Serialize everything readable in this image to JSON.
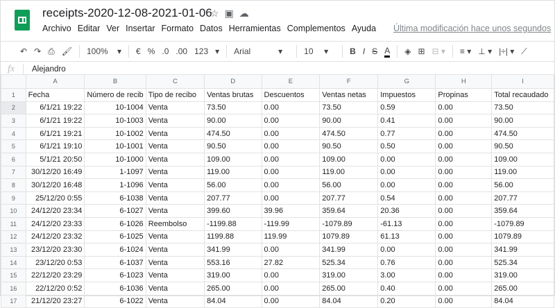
{
  "app": {
    "title": "receipts-2020-12-08-2021-01-06",
    "last_modified": "Última modificación hace unos segundos",
    "menu": [
      "Archivo",
      "Editar",
      "Ver",
      "Insertar",
      "Formato",
      "Datos",
      "Herramientas",
      "Complementos",
      "Ayuda"
    ]
  },
  "toolbar": {
    "zoom": "100%",
    "currency": "€",
    "percent": "%",
    "dec_less": ".0",
    "dec_more": ".00",
    "format": "123",
    "font": "Arial",
    "font_size": "10"
  },
  "formula_bar": {
    "fx": "fx",
    "value": "Alejandro"
  },
  "sheet": {
    "columns": [
      "A",
      "B",
      "C",
      "D",
      "E",
      "F",
      "G",
      "H",
      "I"
    ],
    "rows": [
      [
        "Fecha",
        "Número de recib",
        "Tipo de recibo",
        "Ventas brutas",
        "Descuentos",
        "Ventas netas",
        "Impuestos",
        "Propinas",
        "Total recaudado"
      ],
      [
        "6/1/21 19:22",
        "10-1004",
        "Venta",
        "73.50",
        "0.00",
        "73.50",
        "0.59",
        "0.00",
        "73.50"
      ],
      [
        "6/1/21 19:22",
        "10-1003",
        "Venta",
        "90.00",
        "0.00",
        "90.00",
        "0.41",
        "0.00",
        "90.00"
      ],
      [
        "6/1/21 19:21",
        "10-1002",
        "Venta",
        "474.50",
        "0.00",
        "474.50",
        "0.77",
        "0.00",
        "474.50"
      ],
      [
        "6/1/21 19:10",
        "10-1001",
        "Venta",
        "90.50",
        "0.00",
        "90.50",
        "0.50",
        "0.00",
        "90.50"
      ],
      [
        "5/1/21 20:50",
        "10-1000",
        "Venta",
        "109.00",
        "0.00",
        "109.00",
        "0.00",
        "0.00",
        "109.00"
      ],
      [
        "30/12/20 16:49",
        "1-1097",
        "Venta",
        "119.00",
        "0.00",
        "119.00",
        "0.00",
        "0.00",
        "119.00"
      ],
      [
        "30/12/20 16:48",
        "1-1096",
        "Venta",
        "56.00",
        "0.00",
        "56.00",
        "0.00",
        "0.00",
        "56.00"
      ],
      [
        "25/12/20 0:55",
        "6-1038",
        "Venta",
        "207.77",
        "0.00",
        "207.77",
        "0.54",
        "0.00",
        "207.77"
      ],
      [
        "24/12/20 23:34",
        "6-1027",
        "Venta",
        "399.60",
        "39.96",
        "359.64",
        "20.36",
        "0.00",
        "359.64"
      ],
      [
        "24/12/20 23:33",
        "6-1026",
        "Reembolso",
        "-1199.88",
        "-119.99",
        "-1079.89",
        "-61.13",
        "0.00",
        "-1079.89"
      ],
      [
        "24/12/20 23:32",
        "6-1025",
        "Venta",
        "1199.88",
        "119.99",
        "1079.89",
        "61.13",
        "0.00",
        "1079.89"
      ],
      [
        "23/12/20 23:30",
        "6-1024",
        "Venta",
        "341.99",
        "0.00",
        "341.99",
        "0.00",
        "0.00",
        "341.99"
      ],
      [
        "23/12/20 0:53",
        "6-1037",
        "Venta",
        "553.16",
        "27.82",
        "525.34",
        "0.76",
        "0.00",
        "525.34"
      ],
      [
        "22/12/20 23:29",
        "6-1023",
        "Venta",
        "319.00",
        "0.00",
        "319.00",
        "3.00",
        "0.00",
        "319.00"
      ],
      [
        "22/12/20 0:52",
        "6-1036",
        "Venta",
        "265.00",
        "0.00",
        "265.00",
        "0.40",
        "0.00",
        "265.00"
      ],
      [
        "21/12/20 23:27",
        "6-1022",
        "Venta",
        "84.04",
        "0.00",
        "84.04",
        "0.20",
        "0.00",
        "84.04"
      ]
    ]
  }
}
